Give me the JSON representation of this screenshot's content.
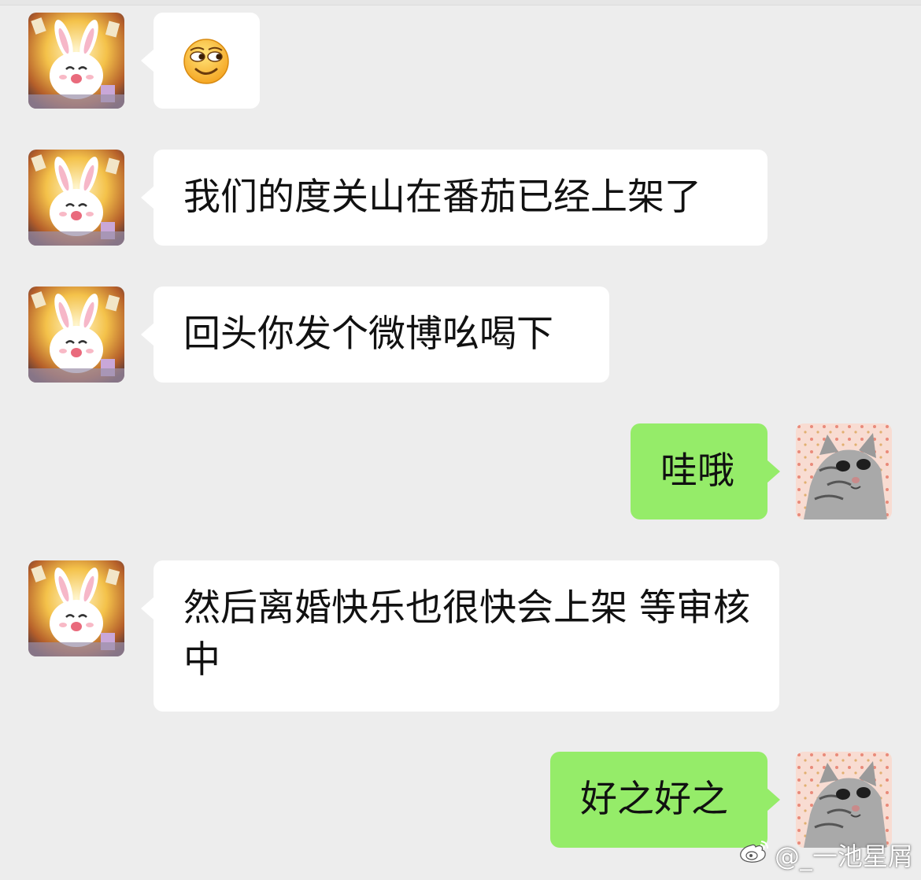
{
  "chat": {
    "messages": [
      {
        "side": "left",
        "type": "emoji",
        "emoji_name": "smirk-emoji-icon"
      },
      {
        "side": "left",
        "type": "text",
        "text": "我们的度关山在番茄已经上架了"
      },
      {
        "side": "left",
        "type": "text",
        "text": "回头你发个微博吆喝下"
      },
      {
        "side": "right",
        "type": "text",
        "text": "哇哦"
      },
      {
        "side": "left",
        "type": "text",
        "text": "然后离婚快乐也很快会上架 等审核中"
      },
      {
        "side": "right",
        "type": "text",
        "text": "好之好之"
      }
    ],
    "avatars": {
      "left": "bunny-avatar",
      "right": "cat-avatar"
    }
  },
  "watermark": {
    "logo": "weibo-logo-icon",
    "text": "@_一池星屑"
  },
  "colors": {
    "background": "#ededed",
    "incoming_bubble": "#ffffff",
    "outgoing_bubble": "#95ec69",
    "text": "#111111"
  }
}
